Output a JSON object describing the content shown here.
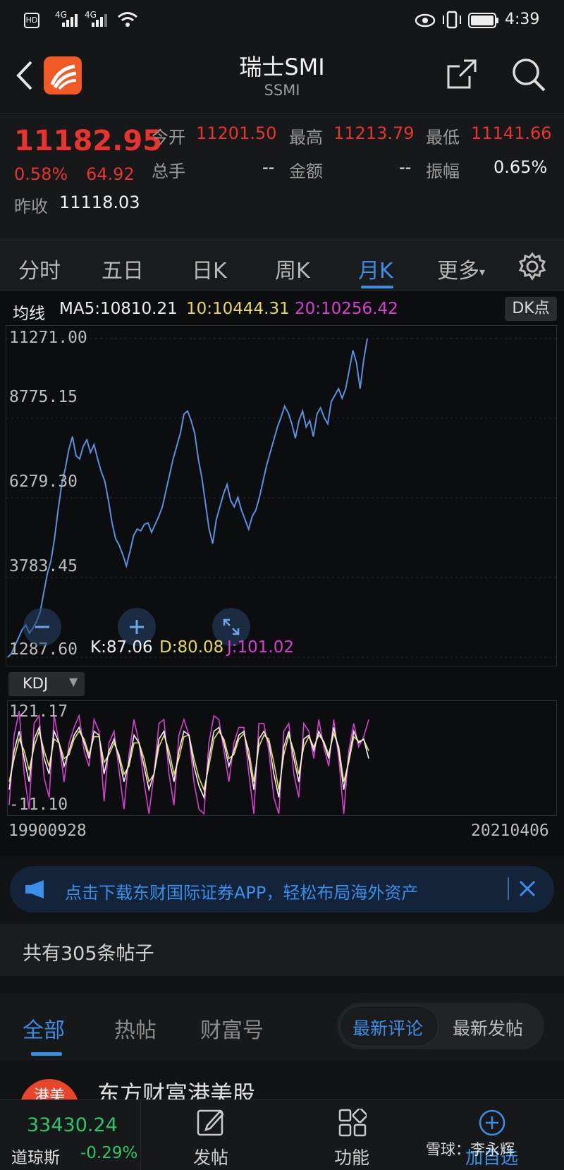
{
  "status": {
    "time": "4:39",
    "net1": "4G",
    "net2": "4G",
    "hd": "HD"
  },
  "header": {
    "title": "瑞士SMI",
    "subtitle": "SSMI"
  },
  "quote": {
    "price": "11182.95",
    "change_pct": "0.58%",
    "change_abs": "64.92",
    "prev_close_label": "昨收",
    "prev_close": "11118.03",
    "open_label": "今开",
    "open": "11201.50",
    "high_label": "最高",
    "high": "11213.79",
    "low_label": "最低",
    "low": "11141.66",
    "volume_label": "总手",
    "volume": "--",
    "amount_label": "金额",
    "amount": "--",
    "amplitude_label": "振幅",
    "amplitude": "0.65%"
  },
  "tabs": [
    {
      "label": "分时"
    },
    {
      "label": "五日"
    },
    {
      "label": "日K"
    },
    {
      "label": "周K"
    },
    {
      "label": "月K",
      "active": true
    },
    {
      "label": "更多"
    }
  ],
  "ma": {
    "label": "均线",
    "ma5": "MA5:10810.21",
    "ma10": "10:10444.31",
    "ma20": "20:10256.42",
    "dk_button": "DK点"
  },
  "kdj": {
    "selector": "KDJ",
    "k": "K:87.06",
    "d": "D:80.08",
    "j": "J:101.02"
  },
  "colors": {
    "up": "#e8332f",
    "price_line": "#5b8fe0",
    "ma10": "#e6d85a",
    "ma20": "#d63fd0",
    "accent": "#3b8fe8"
  },
  "chart_data": [
    {
      "type": "line",
      "series": [
        {
          "values": [
            1287.6,
            1400,
            1650,
            1900,
            2150,
            2300,
            2050,
            2200,
            2400,
            2700,
            3300,
            3900,
            4300,
            5000,
            5900,
            6700,
            7200,
            7800,
            8200,
            7600,
            7500,
            7900,
            8100,
            7700,
            7950,
            7500,
            7100,
            6800,
            6200,
            5500,
            5000,
            4800,
            4500,
            4150,
            4600,
            5100,
            5300,
            5250,
            5450,
            5500,
            5200,
            5450,
            5700,
            6000,
            6500,
            7000,
            7500,
            7900,
            8300,
            8900,
            9000,
            8700,
            8300,
            7500,
            6900,
            6100,
            5300,
            4850,
            5600,
            6000,
            6400,
            6700,
            6200,
            6000,
            6300,
            5900,
            5600,
            5300,
            5700,
            5900,
            6300,
            6800,
            7300,
            7700,
            8100,
            8500,
            8800,
            9150,
            8950,
            8600,
            8150,
            8700,
            9000,
            8500,
            8700,
            8200,
            8900,
            9100,
            8800,
            8600,
            9300,
            9500,
            9700,
            9400,
            9700,
            10300,
            10900,
            10500,
            9700,
            10600,
            11271
          ]
        }
      ],
      "ylim": [
        1287.6,
        11271.0
      ],
      "y_ticks": [
        "11271.00",
        "8775.15",
        "6279.30",
        "3783.45",
        "1287.60"
      ],
      "x_range_labels": [
        "19900928",
        "20210406"
      ]
    },
    {
      "type": "line",
      "series": [
        {
          "name": "K",
          "values": [
            20,
            70,
            95,
            60,
            30,
            85,
            100,
            60,
            40,
            95,
            80,
            50,
            70,
            90,
            100,
            80,
            60,
            95,
            90,
            40,
            70,
            85,
            60,
            30,
            55,
            90,
            80,
            50,
            20,
            40,
            85,
            95,
            60,
            30,
            70,
            95,
            90,
            50,
            25,
            10,
            60,
            95,
            100,
            80,
            50,
            70,
            90,
            95,
            60,
            20,
            85,
            95,
            80,
            40,
            10,
            75,
            95,
            60,
            30,
            85,
            90,
            70,
            95,
            80,
            60,
            100,
            70,
            20,
            60,
            95,
            80,
            85,
            60
          ]
        },
        {
          "name": "D",
          "values": [
            30,
            60,
            85,
            70,
            45,
            75,
            95,
            70,
            50,
            85,
            80,
            60,
            65,
            85,
            95,
            85,
            65,
            88,
            88,
            55,
            65,
            80,
            65,
            40,
            50,
            80,
            80,
            60,
            30,
            40,
            75,
            90,
            70,
            40,
            60,
            88,
            90,
            60,
            35,
            20,
            50,
            85,
            95,
            85,
            60,
            65,
            85,
            92,
            70,
            30,
            75,
            90,
            85,
            55,
            20,
            65,
            90,
            70,
            40,
            75,
            88,
            75,
            90,
            82,
            65,
            92,
            75,
            30,
            55,
            88,
            82,
            84,
            70
          ]
        },
        {
          "name": "J",
          "values": [
            0,
            90,
            121.17,
            40,
            -5,
            105,
            115,
            35,
            10,
            115,
            80,
            30,
            80,
            100,
            115,
            70,
            50,
            110,
            95,
            5,
            80,
            95,
            45,
            -5,
            65,
            110,
            80,
            30,
            -11.1,
            40,
            105,
            110,
            40,
            0,
            90,
            110,
            90,
            30,
            -5,
            -11.1,
            80,
            115,
            110,
            70,
            30,
            80,
            100,
            100,
            40,
            -11.1,
            105,
            105,
            70,
            10,
            -11.1,
            95,
            105,
            40,
            10,
            105,
            95,
            60,
            110,
            75,
            50,
            110,
            60,
            -11.1,
            70,
            105,
            75,
            88,
            110
          ]
        }
      ],
      "ylim": [
        -11.1,
        121.17
      ],
      "y_ticks": [
        "121.17",
        "-11.10"
      ]
    }
  ],
  "banner": {
    "text": "点击下载东财国际证券APP，轻松布局海外资产"
  },
  "posts": {
    "count_text": "共有305条帖子"
  },
  "feed": {
    "tabs": [
      "全部",
      "热帖",
      "财富号"
    ],
    "sort_options": [
      "最新评论",
      "最新发帖"
    ],
    "partial_author": "东方财富港美股",
    "partial_avatar": "港美"
  },
  "bottom": {
    "index_value": "33430.24",
    "index_name": "道琼斯",
    "index_change": "-0.29%",
    "post_label": "发帖",
    "func_label": "功能",
    "watch_label": "加自选",
    "watermark": "雪球：李永辉"
  }
}
